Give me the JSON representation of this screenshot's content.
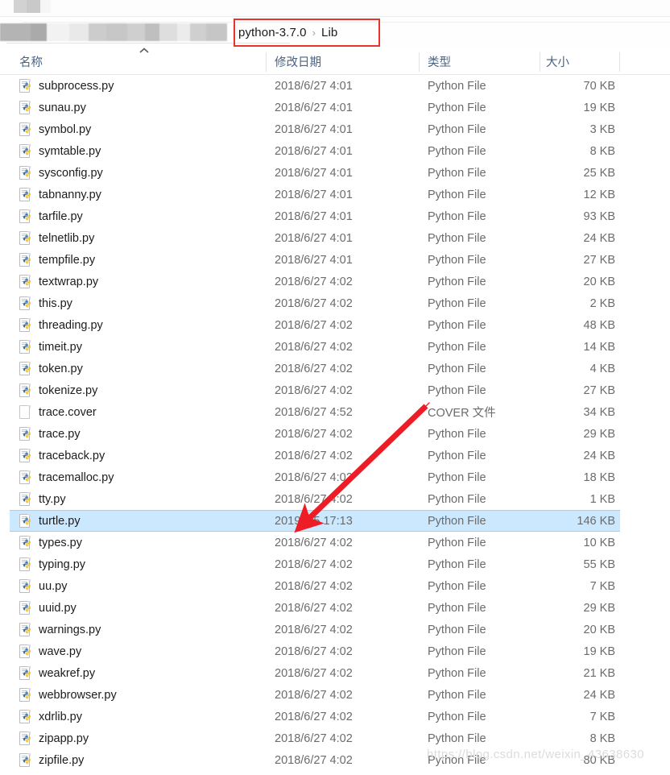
{
  "window": {
    "breadcrumb": {
      "crumbs": [
        "python-3.7.0",
        "Lib"
      ],
      "separator": "›"
    },
    "annotation": {
      "highlight_color": "#e8342a",
      "arrow_color": "#ee1c25",
      "arrow_target": "turtle.py"
    }
  },
  "columns": [
    {
      "key": "name",
      "label": "名称",
      "sorted": "asc",
      "sort_glyph": "^"
    },
    {
      "key": "date",
      "label": "修改日期"
    },
    {
      "key": "type",
      "label": "类型"
    },
    {
      "key": "size",
      "label": "大小"
    }
  ],
  "selection": {
    "selected_name": "turtle.py",
    "highlight_color": "#cce8ff"
  },
  "files": [
    {
      "name": "subprocess.py",
      "date": "2018/6/27 4:01",
      "type": "Python File",
      "size": "70 KB",
      "icon": "python-file-icon",
      "selected": false
    },
    {
      "name": "sunau.py",
      "date": "2018/6/27 4:01",
      "type": "Python File",
      "size": "19 KB",
      "icon": "python-file-icon",
      "selected": false
    },
    {
      "name": "symbol.py",
      "date": "2018/6/27 4:01",
      "type": "Python File",
      "size": "3 KB",
      "icon": "python-file-icon",
      "selected": false
    },
    {
      "name": "symtable.py",
      "date": "2018/6/27 4:01",
      "type": "Python File",
      "size": "8 KB",
      "icon": "python-file-icon",
      "selected": false
    },
    {
      "name": "sysconfig.py",
      "date": "2018/6/27 4:01",
      "type": "Python File",
      "size": "25 KB",
      "icon": "python-file-icon",
      "selected": false
    },
    {
      "name": "tabnanny.py",
      "date": "2018/6/27 4:01",
      "type": "Python File",
      "size": "12 KB",
      "icon": "python-file-icon",
      "selected": false
    },
    {
      "name": "tarfile.py",
      "date": "2018/6/27 4:01",
      "type": "Python File",
      "size": "93 KB",
      "icon": "python-file-icon",
      "selected": false
    },
    {
      "name": "telnetlib.py",
      "date": "2018/6/27 4:01",
      "type": "Python File",
      "size": "24 KB",
      "icon": "python-file-icon",
      "selected": false
    },
    {
      "name": "tempfile.py",
      "date": "2018/6/27 4:01",
      "type": "Python File",
      "size": "27 KB",
      "icon": "python-file-icon",
      "selected": false
    },
    {
      "name": "textwrap.py",
      "date": "2018/6/27 4:02",
      "type": "Python File",
      "size": "20 KB",
      "icon": "python-file-icon",
      "selected": false
    },
    {
      "name": "this.py",
      "date": "2018/6/27 4:02",
      "type": "Python File",
      "size": "2 KB",
      "icon": "python-file-icon",
      "selected": false
    },
    {
      "name": "threading.py",
      "date": "2018/6/27 4:02",
      "type": "Python File",
      "size": "48 KB",
      "icon": "python-file-icon",
      "selected": false
    },
    {
      "name": "timeit.py",
      "date": "2018/6/27 4:02",
      "type": "Python File",
      "size": "14 KB",
      "icon": "python-file-icon",
      "selected": false
    },
    {
      "name": "token.py",
      "date": "2018/6/27 4:02",
      "type": "Python File",
      "size": "4 KB",
      "icon": "python-file-icon",
      "selected": false
    },
    {
      "name": "tokenize.py",
      "date": "2018/6/27 4:02",
      "type": "Python File",
      "size": "27 KB",
      "icon": "python-file-icon",
      "selected": false
    },
    {
      "name": "trace.cover",
      "date": "2018/6/27 4:52",
      "type": "COVER 文件",
      "size": "34 KB",
      "icon": "blank-file-icon",
      "selected": false
    },
    {
      "name": "trace.py",
      "date": "2018/6/27 4:02",
      "type": "Python File",
      "size": "29 KB",
      "icon": "python-file-icon",
      "selected": false
    },
    {
      "name": "traceback.py",
      "date": "2018/6/27 4:02",
      "type": "Python File",
      "size": "24 KB",
      "icon": "python-file-icon",
      "selected": false
    },
    {
      "name": "tracemalloc.py",
      "date": "2018/6/27 4:02",
      "type": "Python File",
      "size": "18 KB",
      "icon": "python-file-icon",
      "selected": false
    },
    {
      "name": "tty.py",
      "date": "2018/6/27 4:02",
      "type": "Python File",
      "size": "1 KB",
      "icon": "python-file-icon",
      "selected": false
    },
    {
      "name": "turtle.py",
      "date": "2019/9/5 17:13",
      "type": "Python File",
      "size": "146 KB",
      "icon": "python-file-icon",
      "selected": true
    },
    {
      "name": "types.py",
      "date": "2018/6/27 4:02",
      "type": "Python File",
      "size": "10 KB",
      "icon": "python-file-icon",
      "selected": false
    },
    {
      "name": "typing.py",
      "date": "2018/6/27 4:02",
      "type": "Python File",
      "size": "55 KB",
      "icon": "python-file-icon",
      "selected": false
    },
    {
      "name": "uu.py",
      "date": "2018/6/27 4:02",
      "type": "Python File",
      "size": "7 KB",
      "icon": "python-file-icon",
      "selected": false
    },
    {
      "name": "uuid.py",
      "date": "2018/6/27 4:02",
      "type": "Python File",
      "size": "29 KB",
      "icon": "python-file-icon",
      "selected": false
    },
    {
      "name": "warnings.py",
      "date": "2018/6/27 4:02",
      "type": "Python File",
      "size": "20 KB",
      "icon": "python-file-icon",
      "selected": false
    },
    {
      "name": "wave.py",
      "date": "2018/6/27 4:02",
      "type": "Python File",
      "size": "19 KB",
      "icon": "python-file-icon",
      "selected": false
    },
    {
      "name": "weakref.py",
      "date": "2018/6/27 4:02",
      "type": "Python File",
      "size": "21 KB",
      "icon": "python-file-icon",
      "selected": false
    },
    {
      "name": "webbrowser.py",
      "date": "2018/6/27 4:02",
      "type": "Python File",
      "size": "24 KB",
      "icon": "python-file-icon",
      "selected": false
    },
    {
      "name": "xdrlib.py",
      "date": "2018/6/27 4:02",
      "type": "Python File",
      "size": "7 KB",
      "icon": "python-file-icon",
      "selected": false
    },
    {
      "name": "zipapp.py",
      "date": "2018/6/27 4:02",
      "type": "Python File",
      "size": "8 KB",
      "icon": "python-file-icon",
      "selected": false
    },
    {
      "name": "zipfile.py",
      "date": "2018/6/27 4:02",
      "type": "Python File",
      "size": "80 KB",
      "icon": "python-file-icon",
      "selected": false
    }
  ],
  "watermark": {
    "text": "https://blog.csdn.net/weixin_43638630"
  }
}
